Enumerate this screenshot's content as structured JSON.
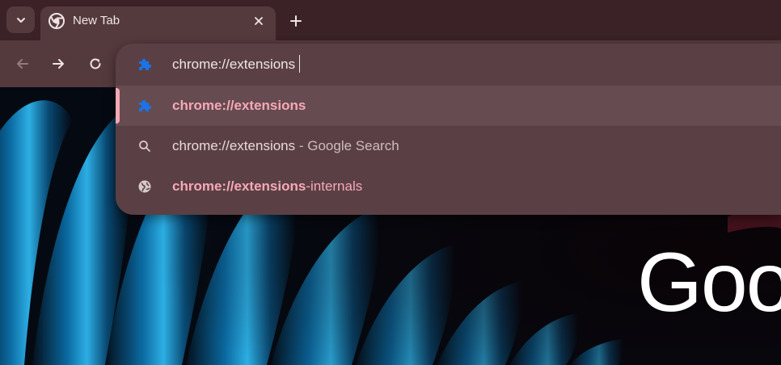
{
  "tabstrip": {
    "tab": {
      "title": "New Tab"
    }
  },
  "omnibox": {
    "input_value": "chrome://extensions",
    "suggestions": [
      {
        "type": "extension",
        "match": "chrome://extensions",
        "rest": "",
        "selected": true
      },
      {
        "type": "search",
        "match": "chrome://extensions",
        "rest": " - Google Search",
        "selected": false
      },
      {
        "type": "url",
        "match": "chrome://extensions",
        "rest": "-internals",
        "selected": false
      }
    ]
  },
  "page": {
    "logo_text": "Goo"
  },
  "colors": {
    "accent_pink": "#f7a8b8",
    "extension_icon_blue": "#1a73e8",
    "toolbar_bg": "#553a3d",
    "tabstrip_bg": "#3a2226"
  }
}
